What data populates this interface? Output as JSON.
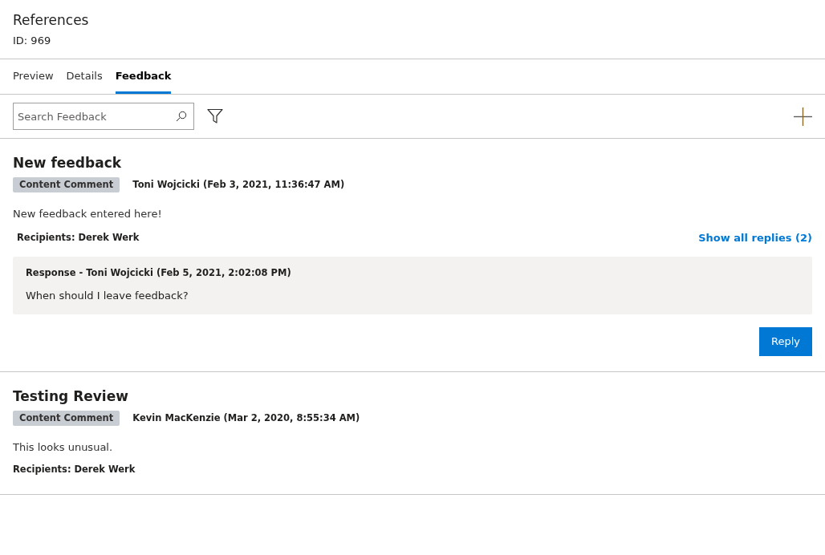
{
  "header": {
    "title": "References",
    "id": "ID: 969"
  },
  "tabs": [
    {
      "label": "Preview",
      "selected": false
    },
    {
      "label": "Details",
      "selected": false
    },
    {
      "label": "Feedback",
      "selected": true
    }
  ],
  "search": {
    "placeholder": "Search Feedback"
  },
  "feedback": [
    {
      "title": "New feedback",
      "tag": "Content Comment",
      "author": "Toni Wojcicki (Feb 3, 2021, 11:36:47 AM)",
      "text": "New feedback entered here!",
      "recipients": "Recipients: Derek Werk",
      "show_replies": "Show all replies (2)",
      "responses": [
        {
          "heading": "Response - Toni Wojcicki (Feb 5, 2021, 2:02:08 PM)",
          "text": "When should I leave feedback?"
        }
      ],
      "reply_button": "Reply"
    },
    {
      "title": "Testing Review",
      "tag": "Content Comment",
      "author": "Kevin MacKenzie (Mar 2, 2020, 8:55:34 AM)",
      "text": "This looks unusual.",
      "recipients": "Recipients: Derek Werk"
    }
  ]
}
